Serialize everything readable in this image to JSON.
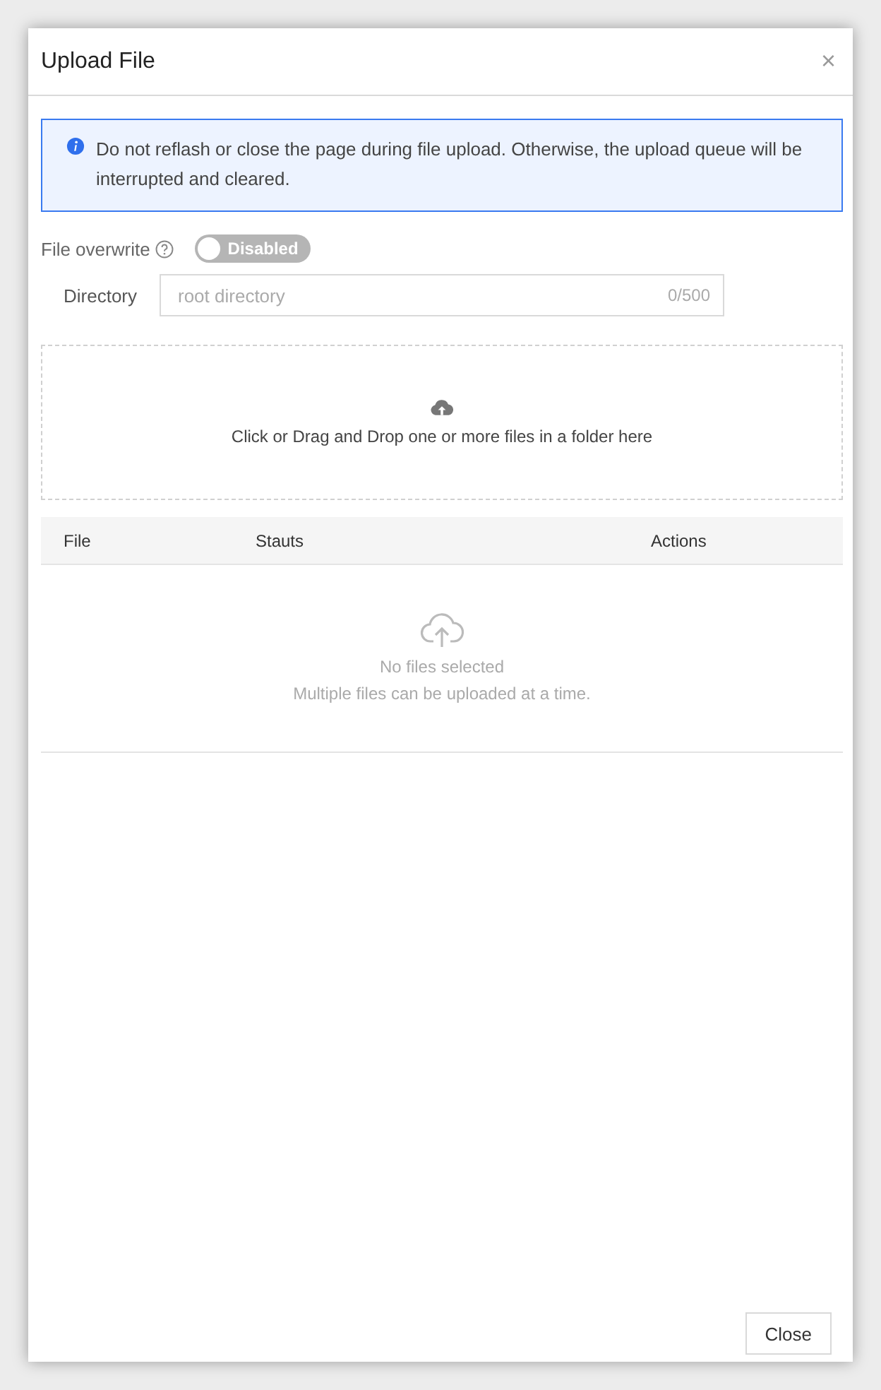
{
  "dialog": {
    "title": "Upload File",
    "close_symbol": "×"
  },
  "alert": {
    "text": "Do not reflash or close the page during file upload. Otherwise, the upload queue will be interrupted and cleared."
  },
  "overwrite": {
    "label": "File overwrite",
    "switch_label": "Disabled",
    "on": false
  },
  "directory": {
    "label": "Directory",
    "placeholder": "root directory",
    "counter": "0/500"
  },
  "dropzone": {
    "text": "Click or Drag and Drop one or more files in a folder here"
  },
  "table": {
    "columns": [
      "File",
      "Stauts",
      "Actions"
    ],
    "empty_title": "No files selected",
    "empty_hint": "Multiple files can be uploaded at a time."
  },
  "footer": {
    "button": "Close"
  }
}
